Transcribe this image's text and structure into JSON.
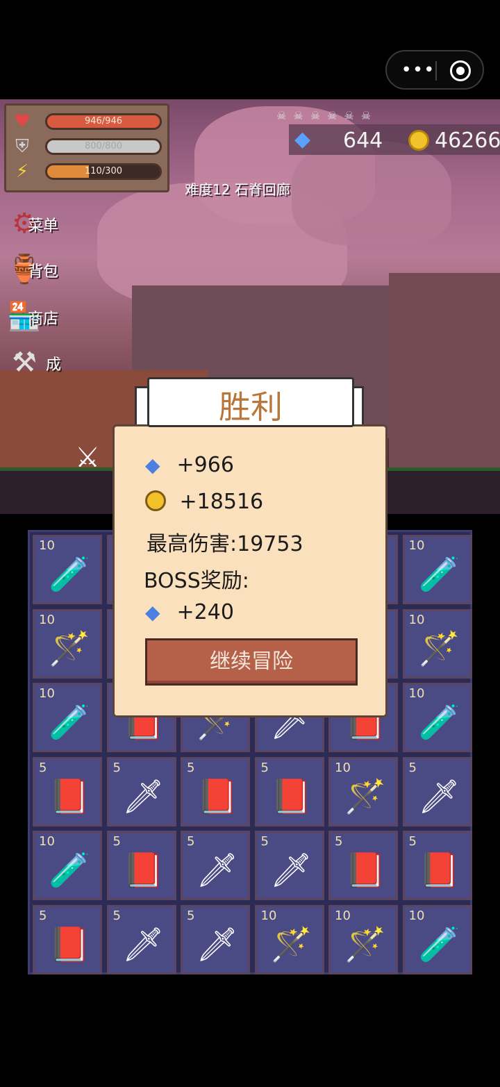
{
  "topbar": {
    "more_icon": "more-dots-icon",
    "target_icon": "target-icon"
  },
  "hud": {
    "hp": {
      "text": "946/946",
      "fraction": 1.0,
      "color": "#d85a40"
    },
    "shield": {
      "text": "800/800",
      "fraction": 1.0,
      "color": "#c8c8c8"
    },
    "energy": {
      "text": "110/300",
      "fraction": 0.37,
      "color": "#e08a3b"
    },
    "boss_progress": "☠☠☠☠☠☠",
    "gems": "644",
    "coins": "46266",
    "level": "难度12 石脊回廊"
  },
  "side_menu": [
    {
      "label": "菜单",
      "icon": "gear-icon",
      "glyph": "⚙"
    },
    {
      "label": "背包",
      "icon": "pot-icon",
      "glyph": "🏺"
    },
    {
      "label": "商店",
      "icon": "shop-icon",
      "glyph": "🏪"
    },
    {
      "label": "成",
      "icon": "anvil-icon",
      "glyph": "⚒"
    }
  ],
  "popup": {
    "title": "胜利",
    "gem_reward": "+966",
    "coin_reward": "+18516",
    "max_damage": "最高伤害:19753",
    "boss_label": "BOSS奖励:",
    "boss_gem_reward": "+240",
    "continue_label": "继续冒险"
  },
  "inventory": [
    {
      "count": "10",
      "item": "potion"
    },
    {
      "count": "",
      "item": "hidden"
    },
    {
      "count": "",
      "item": "hidden"
    },
    {
      "count": "",
      "item": "hidden"
    },
    {
      "count": "",
      "item": "hidden"
    },
    {
      "count": "10",
      "item": "potion"
    },
    {
      "count": "10",
      "item": "staff"
    },
    {
      "count": "",
      "item": "hidden"
    },
    {
      "count": "",
      "item": "hidden"
    },
    {
      "count": "",
      "item": "hidden"
    },
    {
      "count": "",
      "item": "hidden"
    },
    {
      "count": "10",
      "item": "staff"
    },
    {
      "count": "10",
      "item": "potion"
    },
    {
      "count": "",
      "item": "book"
    },
    {
      "count": "",
      "item": "staff"
    },
    {
      "count": "",
      "item": "sword"
    },
    {
      "count": "",
      "item": "book"
    },
    {
      "count": "10",
      "item": "potion"
    },
    {
      "count": "5",
      "item": "book"
    },
    {
      "count": "5",
      "item": "sword"
    },
    {
      "count": "5",
      "item": "book"
    },
    {
      "count": "5",
      "item": "book"
    },
    {
      "count": "10",
      "item": "staff"
    },
    {
      "count": "5",
      "item": "sword"
    },
    {
      "count": "10",
      "item": "potion"
    },
    {
      "count": "5",
      "item": "book"
    },
    {
      "count": "5",
      "item": "sword"
    },
    {
      "count": "5",
      "item": "sword"
    },
    {
      "count": "5",
      "item": "book"
    },
    {
      "count": "5",
      "item": "book"
    },
    {
      "count": "5",
      "item": "book"
    },
    {
      "count": "5",
      "item": "sword"
    },
    {
      "count": "5",
      "item": "sword"
    },
    {
      "count": "10",
      "item": "staff"
    },
    {
      "count": "10",
      "item": "staff"
    },
    {
      "count": "10",
      "item": "potion"
    }
  ]
}
